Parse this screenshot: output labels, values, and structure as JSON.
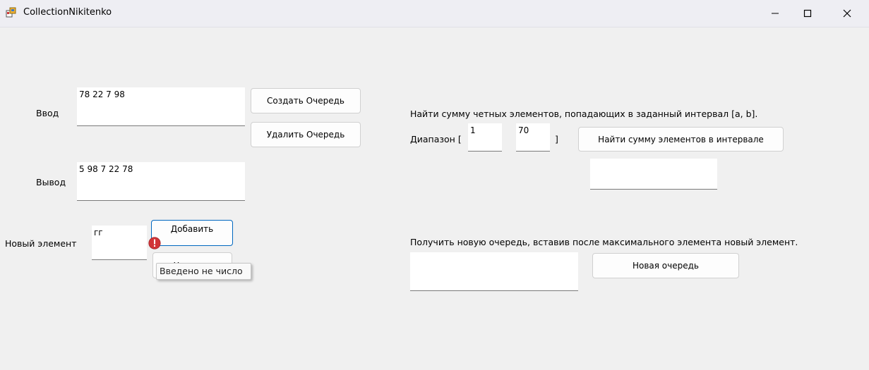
{
  "window": {
    "title": "CollectionNikitenko",
    "minimize_glyph": "—",
    "maximize_glyph": "☐",
    "close_glyph": "✕"
  },
  "input_section": {
    "label": "Ввод",
    "value": "78 22 7 98",
    "create_button": "Создать Очередь",
    "delete_button": "Удалить Очередь"
  },
  "output_section": {
    "label": "Вывод",
    "value": "5 98 7 22 78"
  },
  "new_element": {
    "label": "Новый элемент",
    "value": "гг",
    "add_button": "Добавить",
    "remove_button": "Удалить",
    "error_tooltip": "Введено не число",
    "error_icon": "error-icon"
  },
  "sum_task": {
    "description": "Найти сумму четных элементов, попадающих в заданный интервал [a, b].",
    "range_label": "Диапазон [",
    "range_close": "]",
    "a_value": "1",
    "b_value": "70",
    "find_button": "Найти сумму элементов в интервале",
    "result": ""
  },
  "insert_task": {
    "description": "Получить новую очередь, вставив после максимального элемента новый элемент.",
    "result": "",
    "new_queue_button": "Новая очередь"
  },
  "colors": {
    "background": "#f0f0f0",
    "focus_border": "#0067c0",
    "error_red": "#d13438"
  }
}
